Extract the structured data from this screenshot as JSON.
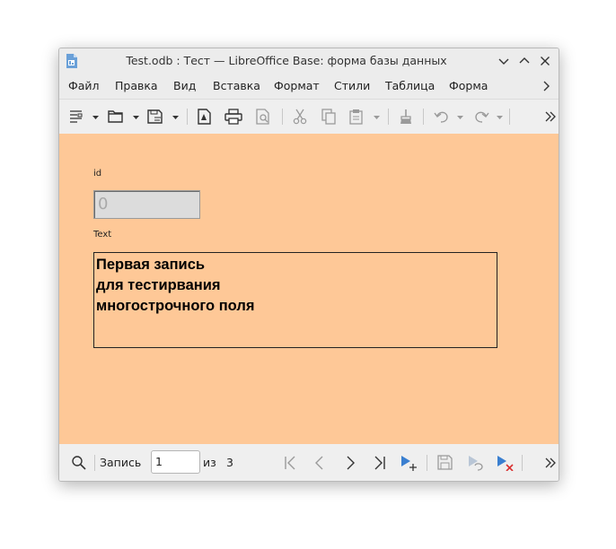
{
  "window": {
    "title": "Test.odb : Тест — LibreOffice Base: форма базы данных"
  },
  "menu": {
    "items": [
      "Файл",
      "Правка",
      "Вид",
      "Вставка",
      "Формат",
      "Стили",
      "Таблица",
      "Форма"
    ]
  },
  "form": {
    "id_label": "id",
    "id_value": "0",
    "text_label": "Text",
    "text_value": "Первая запись\nдля тестирвания\nмногострочного поля"
  },
  "navigation": {
    "record_label": "Запись",
    "record_value": "1",
    "of_label": "из",
    "total": "3"
  },
  "colors": {
    "form_background": "#fec897",
    "window_chrome": "#efefef"
  },
  "icons": {
    "titlebar": [
      "libreoffice-base-icon",
      "minimize-icon",
      "maximize-icon",
      "close-icon"
    ],
    "toolbar": [
      "form-navigator-icon",
      "open-folder-icon",
      "save-icon",
      "export-pdf-icon",
      "print-icon",
      "print-preview-icon",
      "cut-icon",
      "copy-icon",
      "paste-icon",
      "clone-formatting-icon",
      "undo-icon",
      "redo-icon"
    ],
    "navbar": [
      "find-record-icon",
      "first-record-icon",
      "previous-record-icon",
      "next-record-icon",
      "last-record-icon",
      "new-record-icon",
      "save-record-icon",
      "undo-record-icon",
      "delete-record-icon"
    ]
  }
}
